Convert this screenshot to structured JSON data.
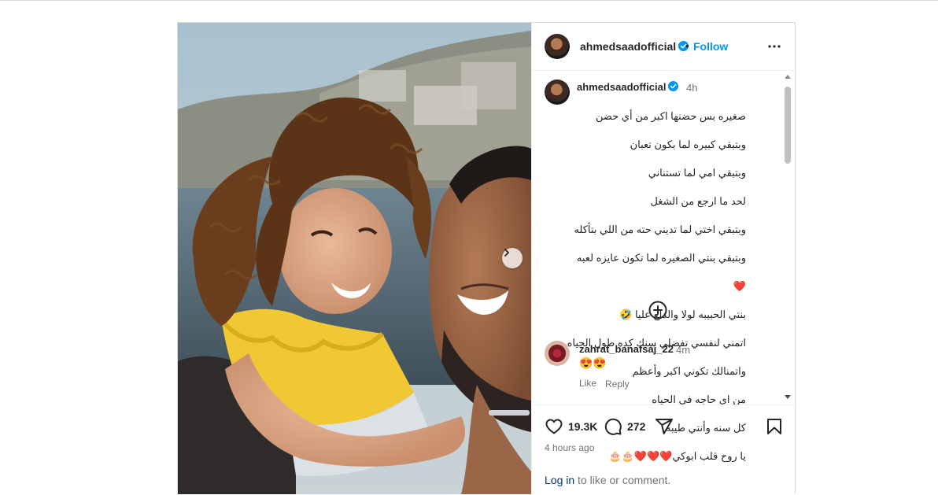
{
  "post": {
    "username": "ahmedsaadofficial",
    "follow_label": "Follow",
    "separator": "•",
    "caption": {
      "username": "ahmedsaadofficial",
      "time": "4h",
      "lines": [
        "صغيره بس حضنها اكبر من أي حضن",
        "وبتبقي كبيره لما بكون تعبان",
        "وبتبقي امي لما تستناني",
        "لحد ما ارجع من الشغل",
        "وبتبقي اختي لما تديني حته من اللي بتأكله",
        "وبتبقي بنتي الصغيره لما تكون عايزه لعبه",
        "❤️",
        "بنتي الحبيبه لولا والدلع عليا 🤣",
        "اتمني لنفسي تفضلي سنك كده طول الحياه",
        "واتمنالك تكوني اكبر وأعظم",
        "من اي حاجه في الحياه",
        "كل سنه وأنتي طيبه",
        "يا روح قلب ابوكي❤️❤️❤️🎂🎂"
      ]
    },
    "comment": {
      "username": "zahrat_banafsaj_22",
      "time": "4m",
      "text": "😍😍",
      "like_label": "Like",
      "reply_label": "Reply"
    },
    "likes": "19.3K",
    "comments_count": "272",
    "time_ago": "4 hours ago",
    "login_link": "Log in",
    "login_suffix": " to like or comment."
  },
  "colors": {
    "accent": "#0095f6",
    "verified": "#0095f6",
    "link_dark": "#00376b",
    "muted": "#737373"
  },
  "icons": {
    "more": "more-options-icon",
    "next": "chevron-right-icon",
    "add": "add-comment-icon",
    "like": "heart-icon",
    "comment": "comment-icon",
    "share": "share-icon",
    "save": "bookmark-icon"
  }
}
